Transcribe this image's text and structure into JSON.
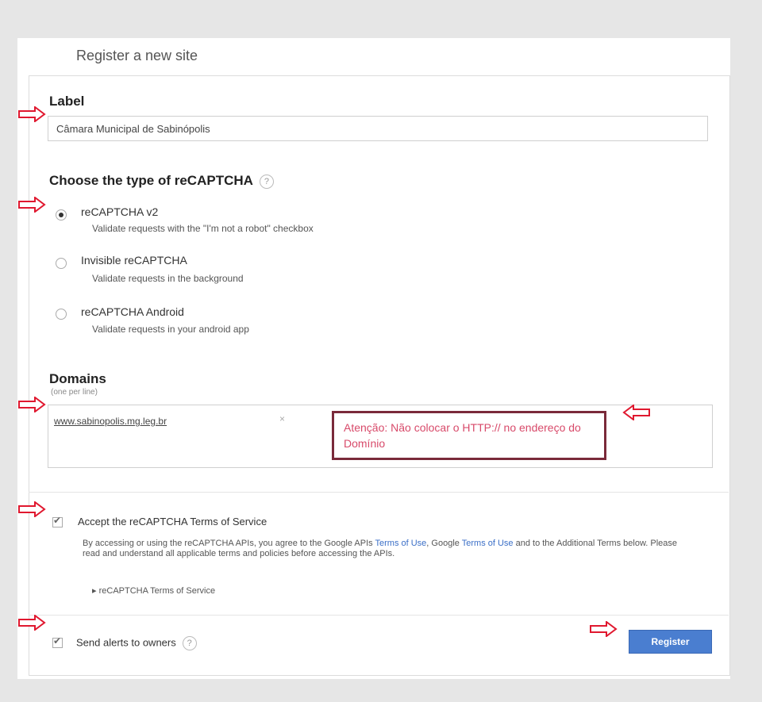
{
  "page": {
    "title": "Register a new site"
  },
  "label_section": {
    "heading": "Label",
    "value": "Câmara Municipal de Sabinópolis"
  },
  "type_section": {
    "heading": "Choose the type of reCAPTCHA",
    "help_icon": "?",
    "options": [
      {
        "title": "reCAPTCHA v2",
        "desc": "Validate requests with the \"I'm not a robot\" checkbox",
        "checked": true
      },
      {
        "title": "Invisible reCAPTCHA",
        "desc": "Validate requests in the background",
        "checked": false
      },
      {
        "title": "reCAPTCHA Android",
        "desc": "Validate requests in your android app",
        "checked": false
      }
    ]
  },
  "domains_section": {
    "heading": "Domains",
    "note": "(one per line)",
    "value": "www.sabinopolis.mg.leg.br",
    "remove_icon": "×",
    "warning": "Atenção: Não colocar o HTTP:// no endereço do Domínio"
  },
  "tos": {
    "checkbox_label": "Accept the reCAPTCHA Terms of Service",
    "body_part1": "By accessing or using the reCAPTCHA APIs, you agree to the Google APIs ",
    "link1": "Terms of Use",
    "body_part2": ", Google ",
    "link2": "Terms of Use",
    "body_part3": " and to the Additional Terms below. Please read and understand all applicable terms and policies before accessing the APIs.",
    "expand_link": "reCAPTCHA Terms of Service",
    "expand_icon": "▸"
  },
  "alerts": {
    "label": "Send alerts to owners",
    "help_icon": "?"
  },
  "actions": {
    "register_label": "Register"
  },
  "colors": {
    "arrow": "#e0182f",
    "button": "#4a7ed0",
    "warning_text": "#d84a6a",
    "warning_border": "#7a2a3a"
  }
}
